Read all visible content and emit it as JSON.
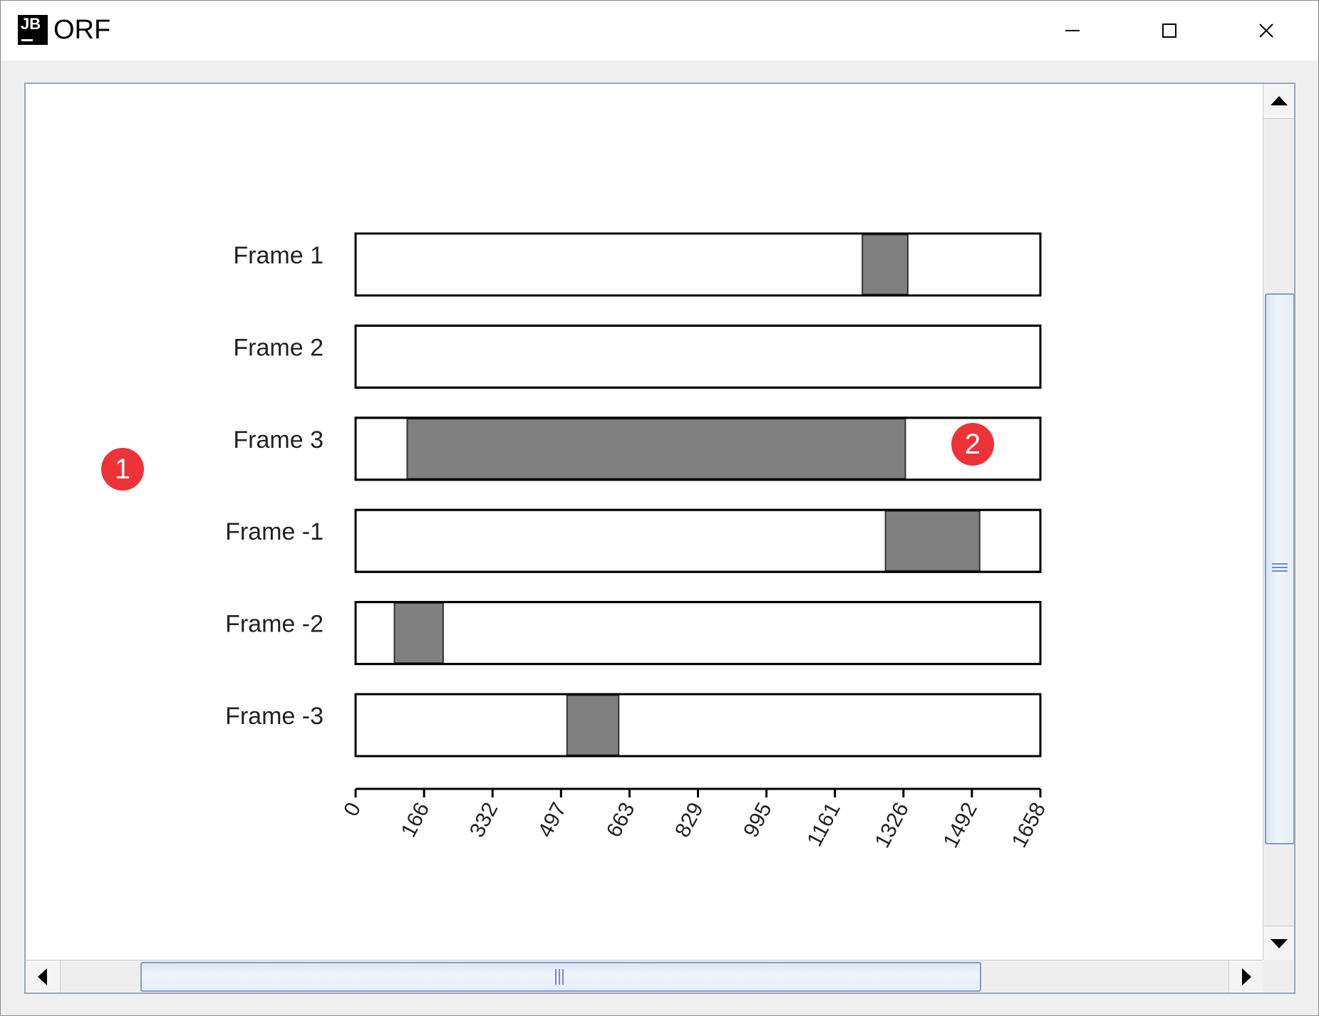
{
  "window": {
    "title": "ORF",
    "icon_text": "JB"
  },
  "annotations": {
    "badge_1": "1",
    "badge_2": "2"
  },
  "colors": {
    "orf_fill": "#808080",
    "track_border": "#000000",
    "badge": "#ee3338",
    "scroll_thumb_border": "#7e9ed0"
  },
  "chart_data": {
    "type": "bar",
    "orientation": "horizontal",
    "xlim": [
      0,
      1658
    ],
    "x_ticks": [
      "0",
      "166",
      "332",
      "497",
      "663",
      "829",
      "995",
      "1161",
      "1326",
      "1492",
      "1658"
    ],
    "tracks": [
      {
        "label": "Frame 1",
        "orfs": [
          [
            1227,
            1337
          ]
        ]
      },
      {
        "label": "Frame 2",
        "orfs": []
      },
      {
        "label": "Frame 3",
        "orfs": [
          [
            125,
            1331
          ]
        ]
      },
      {
        "label": "Frame -1",
        "orfs": [
          [
            1283,
            1511
          ]
        ]
      },
      {
        "label": "Frame -2",
        "orfs": [
          [
            94,
            212
          ]
        ]
      },
      {
        "label": "Frame -3",
        "orfs": [
          [
            512,
            637
          ]
        ]
      }
    ]
  }
}
